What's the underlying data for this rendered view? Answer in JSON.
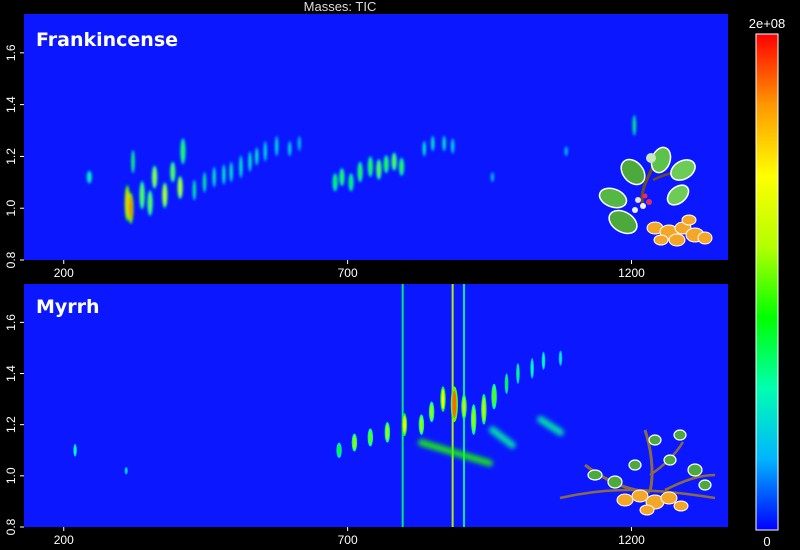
{
  "title": "Masses:  TIC",
  "colors": {
    "background": "#000000",
    "plot_background": "#0a17ff",
    "colormap": [
      "#0000ff",
      "#00b4ff",
      "#00ffb0",
      "#00ff00",
      "#b4ff00",
      "#ffff00",
      "#ff9800",
      "#ff0000"
    ]
  },
  "chart_data": [
    {
      "type": "heatmap",
      "panel_label": "Frankincense",
      "icon": "frankincense-plant-illustration",
      "x_ticks": [
        "200",
        "700",
        "1200"
      ],
      "x_tick_values": [
        200,
        700,
        1200
      ],
      "xlim": [
        130,
        1370
      ],
      "y_ticks": [
        "0.8",
        "1.0",
        "1.2",
        "1.4",
        "1.6"
      ],
      "y_tick_values": [
        0.8,
        1.0,
        1.2,
        1.4,
        1.6
      ],
      "ylim": [
        0.8,
        1.75
      ],
      "peaks": [
        {
          "x": 245,
          "y": 1.12,
          "w": 3,
          "h": 0.05,
          "i": 0.3
        },
        {
          "x": 312,
          "y": 1.02,
          "w": 3,
          "h": 0.14,
          "i": 0.8
        },
        {
          "x": 318,
          "y": 1.0,
          "w": 3,
          "h": 0.12,
          "i": 0.9
        },
        {
          "x": 322,
          "y": 1.18,
          "w": 2,
          "h": 0.09,
          "i": 0.45
        },
        {
          "x": 338,
          "y": 1.05,
          "w": 3,
          "h": 0.11,
          "i": 0.5
        },
        {
          "x": 352,
          "y": 1.02,
          "w": 3,
          "h": 0.1,
          "i": 0.5
        },
        {
          "x": 360,
          "y": 1.12,
          "w": 3,
          "h": 0.09,
          "i": 0.55
        },
        {
          "x": 378,
          "y": 1.05,
          "w": 3,
          "h": 0.1,
          "i": 0.6
        },
        {
          "x": 392,
          "y": 1.14,
          "w": 3,
          "h": 0.08,
          "i": 0.5
        },
        {
          "x": 405,
          "y": 1.08,
          "w": 3,
          "h": 0.09,
          "i": 0.6
        },
        {
          "x": 410,
          "y": 1.22,
          "w": 3,
          "h": 0.1,
          "i": 0.45
        },
        {
          "x": 430,
          "y": 1.07,
          "w": 2,
          "h": 0.08,
          "i": 0.35
        },
        {
          "x": 448,
          "y": 1.1,
          "w": 2,
          "h": 0.08,
          "i": 0.35
        },
        {
          "x": 465,
          "y": 1.12,
          "w": 2,
          "h": 0.08,
          "i": 0.3
        },
        {
          "x": 482,
          "y": 1.13,
          "w": 2,
          "h": 0.08,
          "i": 0.3
        },
        {
          "x": 495,
          "y": 1.14,
          "w": 2,
          "h": 0.08,
          "i": 0.3
        },
        {
          "x": 512,
          "y": 1.16,
          "w": 2,
          "h": 0.09,
          "i": 0.3
        },
        {
          "x": 528,
          "y": 1.18,
          "w": 2,
          "h": 0.08,
          "i": 0.3
        },
        {
          "x": 540,
          "y": 1.2,
          "w": 2,
          "h": 0.07,
          "i": 0.3
        },
        {
          "x": 555,
          "y": 1.22,
          "w": 2,
          "h": 0.08,
          "i": 0.25
        },
        {
          "x": 575,
          "y": 1.24,
          "w": 2,
          "h": 0.08,
          "i": 0.25
        },
        {
          "x": 598,
          "y": 1.23,
          "w": 2,
          "h": 0.06,
          "i": 0.25
        },
        {
          "x": 615,
          "y": 1.25,
          "w": 2,
          "h": 0.06,
          "i": 0.2
        },
        {
          "x": 678,
          "y": 1.1,
          "w": 3,
          "h": 0.07,
          "i": 0.4
        },
        {
          "x": 690,
          "y": 1.12,
          "w": 3,
          "h": 0.07,
          "i": 0.45
        },
        {
          "x": 706,
          "y": 1.1,
          "w": 3,
          "h": 0.07,
          "i": 0.4
        },
        {
          "x": 722,
          "y": 1.14,
          "w": 3,
          "h": 0.08,
          "i": 0.45
        },
        {
          "x": 740,
          "y": 1.16,
          "w": 3,
          "h": 0.08,
          "i": 0.45
        },
        {
          "x": 755,
          "y": 1.15,
          "w": 3,
          "h": 0.08,
          "i": 0.5
        },
        {
          "x": 768,
          "y": 1.17,
          "w": 3,
          "h": 0.07,
          "i": 0.45
        },
        {
          "x": 782,
          "y": 1.18,
          "w": 3,
          "h": 0.07,
          "i": 0.5
        },
        {
          "x": 795,
          "y": 1.16,
          "w": 3,
          "h": 0.07,
          "i": 0.45
        },
        {
          "x": 835,
          "y": 1.23,
          "w": 2,
          "h": 0.06,
          "i": 0.3
        },
        {
          "x": 850,
          "y": 1.25,
          "w": 2,
          "h": 0.06,
          "i": 0.3
        },
        {
          "x": 870,
          "y": 1.25,
          "w": 2,
          "h": 0.06,
          "i": 0.3
        },
        {
          "x": 885,
          "y": 1.24,
          "w": 2,
          "h": 0.06,
          "i": 0.25
        },
        {
          "x": 955,
          "y": 1.12,
          "w": 2,
          "h": 0.04,
          "i": 0.2
        },
        {
          "x": 1085,
          "y": 1.22,
          "w": 2,
          "h": 0.04,
          "i": 0.2
        },
        {
          "x": 1205,
          "y": 1.32,
          "w": 2,
          "h": 0.08,
          "i": 0.4
        }
      ]
    },
    {
      "type": "heatmap",
      "panel_label": "Myrrh",
      "icon": "myrrh-plant-illustration",
      "x_ticks": [
        "200",
        "700",
        "1200"
      ],
      "x_tick_values": [
        200,
        700,
        1200
      ],
      "xlim": [
        130,
        1370
      ],
      "y_ticks": [
        "0.8",
        "1.0",
        "1.2",
        "1.4",
        "1.6"
      ],
      "y_tick_values": [
        0.8,
        1.0,
        1.2,
        1.4,
        1.6
      ],
      "ylim": [
        0.8,
        1.75
      ],
      "peaks": [
        {
          "x": 220,
          "y": 1.1,
          "w": 2,
          "h": 0.05,
          "i": 0.3
        },
        {
          "x": 310,
          "y": 1.02,
          "w": 2,
          "h": 0.03,
          "i": 0.2
        },
        {
          "x": 685,
          "y": 1.1,
          "w": 3,
          "h": 0.06,
          "i": 0.4
        },
        {
          "x": 712,
          "y": 1.13,
          "w": 3,
          "h": 0.07,
          "i": 0.55
        },
        {
          "x": 740,
          "y": 1.15,
          "w": 3,
          "h": 0.07,
          "i": 0.5
        },
        {
          "x": 770,
          "y": 1.17,
          "w": 3,
          "h": 0.08,
          "i": 0.55
        },
        {
          "x": 800,
          "y": 1.2,
          "w": 3,
          "h": 0.09,
          "i": 0.7
        },
        {
          "x": 830,
          "y": 1.2,
          "w": 3,
          "h": 0.08,
          "i": 0.55
        },
        {
          "x": 848,
          "y": 1.25,
          "w": 3,
          "h": 0.08,
          "i": 0.55
        },
        {
          "x": 868,
          "y": 1.3,
          "w": 3,
          "h": 0.1,
          "i": 0.7
        },
        {
          "x": 888,
          "y": 1.28,
          "w": 4,
          "h": 0.14,
          "i": 0.9
        },
        {
          "x": 905,
          "y": 1.27,
          "w": 3,
          "h": 0.1,
          "i": 0.6
        },
        {
          "x": 922,
          "y": 1.22,
          "w": 3,
          "h": 0.12,
          "i": 0.55
        },
        {
          "x": 940,
          "y": 1.26,
          "w": 3,
          "h": 0.12,
          "i": 0.6
        },
        {
          "x": 958,
          "y": 1.31,
          "w": 3,
          "h": 0.1,
          "i": 0.5
        },
        {
          "x": 980,
          "y": 1.36,
          "w": 2,
          "h": 0.08,
          "i": 0.4
        },
        {
          "x": 1000,
          "y": 1.4,
          "w": 2,
          "h": 0.08,
          "i": 0.35
        },
        {
          "x": 1025,
          "y": 1.42,
          "w": 2,
          "h": 0.08,
          "i": 0.3
        },
        {
          "x": 1045,
          "y": 1.45,
          "w": 2,
          "h": 0.07,
          "i": 0.3
        },
        {
          "x": 1075,
          "y": 1.46,
          "w": 2,
          "h": 0.06,
          "i": 0.25
        }
      ],
      "streaks": [
        {
          "x": 797,
          "i": 0.35
        },
        {
          "x": 885,
          "i": 0.6
        },
        {
          "x": 905,
          "i": 0.3
        }
      ],
      "smears": [
        {
          "x1": 830,
          "y1": 1.13,
          "x2": 950,
          "y2": 1.05,
          "i": 0.45
        },
        {
          "x1": 955,
          "y1": 1.18,
          "x2": 990,
          "y2": 1.12,
          "i": 0.3
        },
        {
          "x1": 1040,
          "y1": 1.22,
          "x2": 1075,
          "y2": 1.17,
          "i": 0.3
        }
      ]
    }
  ],
  "colorbar": {
    "max_label": "2e+08",
    "min_label": "0",
    "min": 0,
    "max": 200000000
  }
}
